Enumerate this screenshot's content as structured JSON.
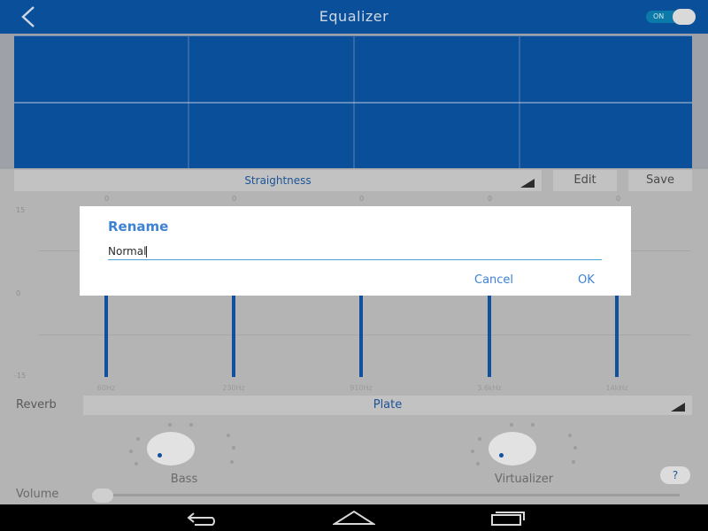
{
  "header": {
    "title": "Equalizer",
    "power_toggle": "ON"
  },
  "preset": {
    "selected": "Straightness",
    "edit_label": "Edit",
    "save_label": "Save"
  },
  "eq": {
    "db_ticks": {
      "top": "15",
      "middle": "0",
      "bottom": "-15"
    },
    "bands": [
      {
        "frequency": "60Hz",
        "gain": "0"
      },
      {
        "frequency": "230Hz",
        "gain": "0"
      },
      {
        "frequency": "910Hz",
        "gain": "0"
      },
      {
        "frequency": "3.6kHz",
        "gain": "0"
      },
      {
        "frequency": "14kHz",
        "gain": "0"
      }
    ]
  },
  "reverb": {
    "label": "Reverb",
    "selected": "Plate"
  },
  "knobs": {
    "bass_label": "Bass",
    "virtualizer_label": "Virtualizer",
    "help_label": "?"
  },
  "volume": {
    "label": "Volume"
  },
  "dialog": {
    "title": "Rename",
    "input_value": "Normal",
    "cancel_label": "Cancel",
    "ok_label": "OK"
  },
  "colors": {
    "accent": "#0a4f9a",
    "dialog_accent": "#3d82d3"
  }
}
